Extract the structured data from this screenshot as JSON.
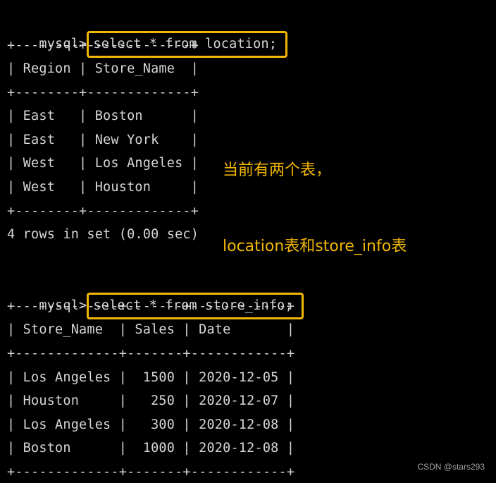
{
  "block1": {
    "prompt": "mysql>",
    "command": "select * from location;",
    "border_top": "+--------+-------------+",
    "header": "| Region | Store_Name  |",
    "border_mid": "+--------+-------------+",
    "rows": [
      "| East   | Boston      |",
      "| East   | New York    |",
      "| West   | Los Angeles |",
      "| West   | Houston     |"
    ],
    "border_bottom": "+--------+-------------+",
    "summary": "4 rows in set (0.00 sec)"
  },
  "block2": {
    "prompt": "mysql>",
    "command": "select * from store_info;",
    "border_top": "+-------------+-------+------------+",
    "header": "| Store_Name  | Sales | Date       |",
    "border_mid": "+-------------+-------+------------+",
    "rows": [
      "| Los Angeles |  1500 | 2020-12-05 |",
      "| Houston     |   250 | 2020-12-07 |",
      "| Los Angeles |   300 | 2020-12-08 |",
      "| Boston      |  1000 | 2020-12-08 |"
    ],
    "border_bottom": "+-------------+-------+------------+"
  },
  "note": {
    "line1": "当前有两个表，",
    "line2": "location表和store_info表"
  },
  "watermark": "CSDN @stars293",
  "colors": {
    "background": "#000000",
    "text": "#d6d6d6",
    "highlight": "#f2b705"
  }
}
